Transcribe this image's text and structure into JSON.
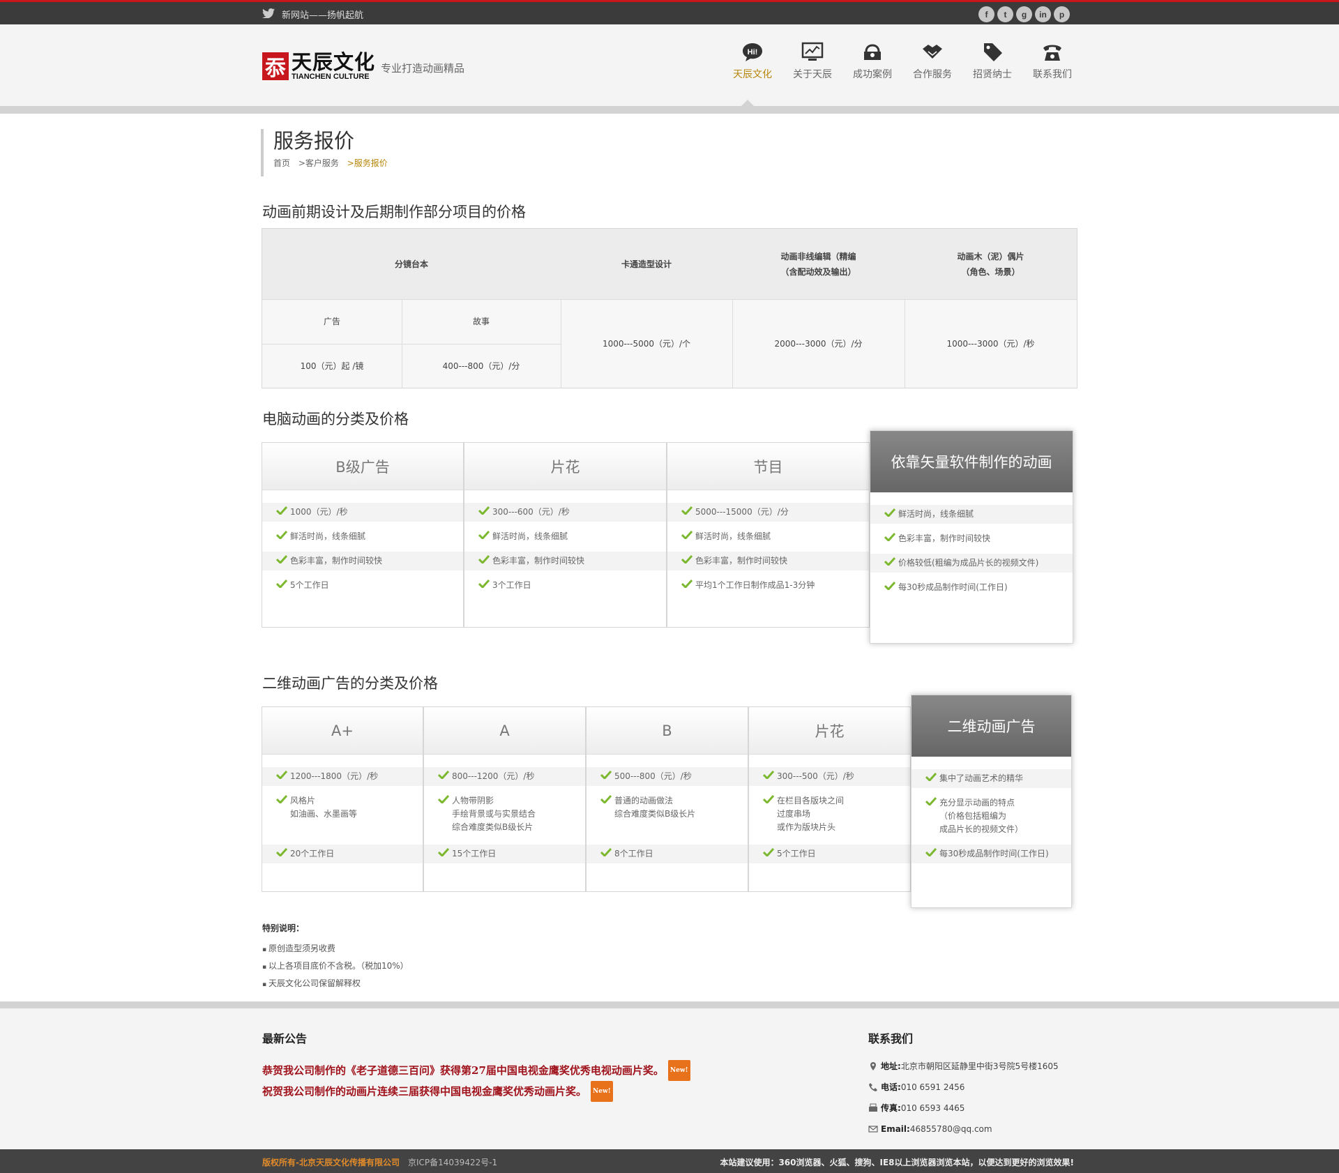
{
  "topbar": {
    "slogan": "新网站——扬帆起航",
    "social": [
      "f",
      "t",
      "g",
      "in",
      "p"
    ]
  },
  "logo": {
    "mark": "忝",
    "cn": "天辰文化",
    "en": "TIANCHEN CULTURE",
    "tagline": "专业打造动画精品"
  },
  "nav": [
    {
      "label": "天辰文化",
      "icon": "hi-bubble-icon",
      "active": true
    },
    {
      "label": "关于天辰",
      "icon": "monitor-chart-icon"
    },
    {
      "label": "成功案例",
      "icon": "briefcase-icon"
    },
    {
      "label": "合作服务",
      "icon": "handshake-icon"
    },
    {
      "label": "招贤纳士",
      "icon": "tag-icon"
    },
    {
      "label": "联系我们",
      "icon": "telephone-icon"
    }
  ],
  "page": {
    "title": "服务报价",
    "breadcrumb": [
      "首页",
      ">客户服务",
      ">服务报价"
    ]
  },
  "section1": {
    "title": "动画前期设计及后期制作部分项目的价格",
    "headers": [
      "分镜台本",
      "卡通造型设计",
      "动画非线编辑（精编\n（含配动效及输出）",
      "动画木（泥）偶片\n（角色、场景）"
    ],
    "sub_headers": [
      "广告",
      "故事"
    ],
    "sub_values": [
      "100（元）起 /镜",
      "400---800（元）/分"
    ],
    "values": [
      "1000---5000（元）/个",
      "2000---3000（元）/分",
      "1000---3000（元）/秒"
    ]
  },
  "section2": {
    "title": "电脑动画的分类及价格",
    "cards": [
      {
        "name": "B级广告",
        "items": [
          "1000（元）/秒",
          "鲜活时尚，线条细腻",
          "色彩丰富，制作时间较快",
          "5个工作日"
        ]
      },
      {
        "name": "片花",
        "items": [
          "300---600（元）/秒",
          "鲜活时尚，线条细腻",
          "色彩丰富，制作时间较快",
          "3个工作日"
        ]
      },
      {
        "name": "节目",
        "items": [
          "5000---15000（元）/分",
          "鲜活时尚，线条细腻",
          "色彩丰富，制作时间较快",
          "平均1个工作日制作成品1-3分钟"
        ]
      }
    ],
    "featured": {
      "name": "依靠矢量软件制作的动画",
      "items": [
        "鲜活时尚，线条细腻",
        "色彩丰富，制作时间较快",
        "价格较低(粗编为成品片长的视频文件)",
        "每30秒成品制作时间(工作日)"
      ]
    }
  },
  "section3": {
    "title": "二维动画广告的分类及价格",
    "cards": [
      {
        "name": "A+",
        "items": [
          "1200---1800（元）/秒",
          "风格片\n如油画、水墨画等",
          "20个工作日"
        ]
      },
      {
        "name": "A",
        "items": [
          "800---1200（元）/秒",
          "人物带阴影\n手绘背景或与实景结合\n综合难度类似B级长片",
          "15个工作日"
        ]
      },
      {
        "name": "B",
        "items": [
          "500---800（元）/秒",
          "普通的动画做法\n综合难度类似B级长片",
          "8个工作日"
        ]
      },
      {
        "name": "片花",
        "items": [
          "300---500（元）/秒",
          "在栏目各版块之间\n过度串场\n或作为版块片头",
          "5个工作日"
        ]
      }
    ],
    "featured": {
      "name": "二维动画广告",
      "items": [
        "集中了动画艺术的精华",
        "充分显示动画的特点\n（价格包括粗编为\n成品片长的视频文件）",
        "每30秒成品制作时间(工作日)"
      ]
    }
  },
  "notes": {
    "title": "特别说明：",
    "items": [
      "原创造型须另收费",
      "以上各项目底价不含税。（税加10%）",
      "天辰文化公司保留解释权"
    ]
  },
  "footer": {
    "news_title": "最新公告",
    "news": [
      "恭贺我公司制作的《老子道德三百问》获得第27届中国电视金鹰奖优秀电视动画片奖。",
      "祝贺我公司制作的动画片连续三届获得中国电视金鹰奖优秀动画片奖。"
    ],
    "new_badge": "New!",
    "contact_title": "联系我们",
    "contact": [
      {
        "label": "地址:",
        "value": "北京市朝阳区延静里中街3号院5号楼1605",
        "icon": "location-pin-icon"
      },
      {
        "label": "电话:",
        "value": "010 6591 2456",
        "icon": "phone-icon"
      },
      {
        "label": "传真:",
        "value": "010 6593 4465",
        "icon": "fax-icon"
      },
      {
        "label": "Email:",
        "value": "46855780@qq.com",
        "icon": "mail-icon"
      }
    ]
  },
  "bottom": {
    "copyright": "版权所有-北京天辰文化传播有限公司",
    "icp": "京ICP备14039422号-1",
    "browser_note": "本站建议使用：360浏览器、火狐、搜狗、IE8以上浏览器浏览本站，以便达到更好的浏览效果!"
  }
}
